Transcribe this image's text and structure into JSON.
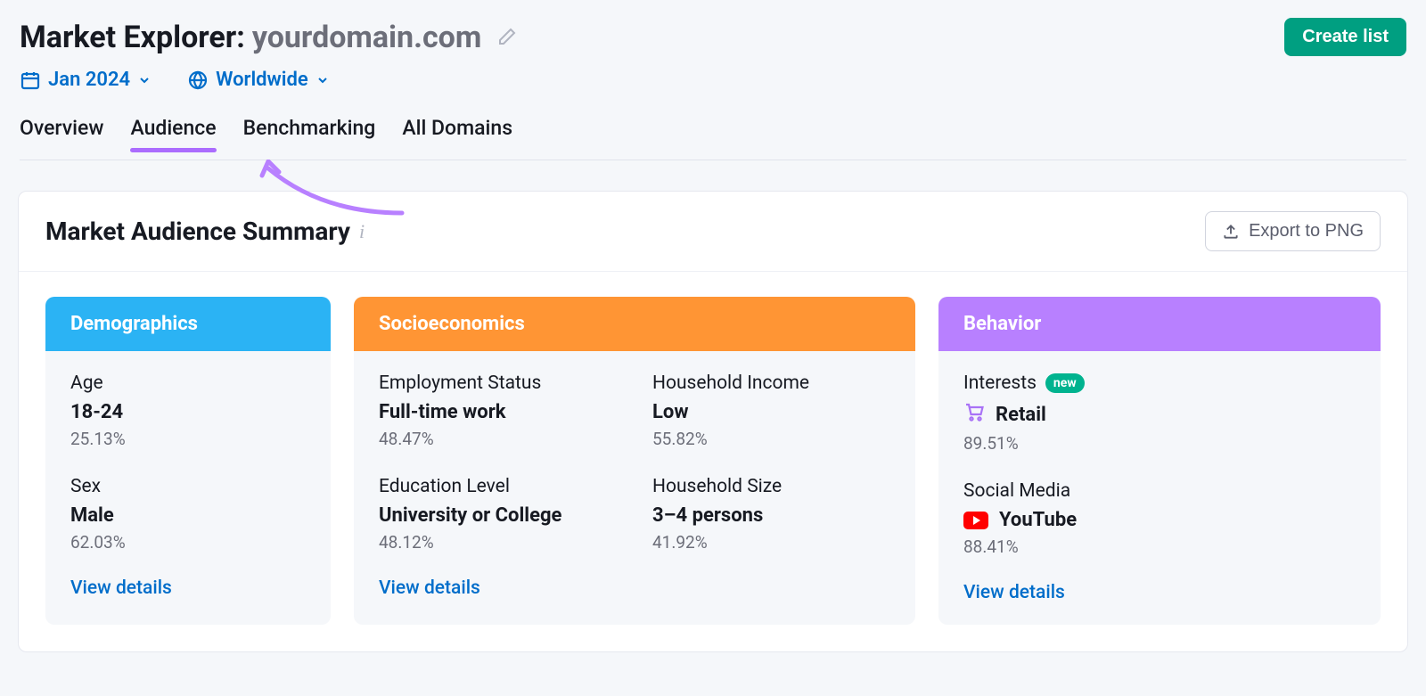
{
  "header": {
    "title_prefix": "Market Explorer: ",
    "domain": "yourdomain.com",
    "create_list_label": "Create list"
  },
  "filters": {
    "date": "Jan 2024",
    "region": "Worldwide"
  },
  "tabs": [
    {
      "label": "Overview",
      "active": false
    },
    {
      "label": "Audience",
      "active": true
    },
    {
      "label": "Benchmarking",
      "active": false
    },
    {
      "label": "All Domains",
      "active": false
    }
  ],
  "card": {
    "title": "Market Audience Summary",
    "export_label": "Export to PNG"
  },
  "panels": {
    "demographics": {
      "title": "Demographics",
      "metrics": [
        {
          "label": "Age",
          "value": "18-24",
          "pct": "25.13%"
        },
        {
          "label": "Sex",
          "value": "Male",
          "pct": "62.03%"
        }
      ],
      "view_details": "View details"
    },
    "socioeconomics": {
      "title": "Socioeconomics",
      "metrics": [
        {
          "label": "Employment Status",
          "value": "Full-time work",
          "pct": "48.47%"
        },
        {
          "label": "Household Income",
          "value": "Low",
          "pct": "55.82%"
        },
        {
          "label": "Education Level",
          "value": "University or College",
          "pct": "48.12%"
        },
        {
          "label": "Household Size",
          "value": "3–4 persons",
          "pct": "41.92%"
        }
      ],
      "view_details": "View details"
    },
    "behavior": {
      "title": "Behavior",
      "interests": {
        "label": "Interests",
        "badge": "new",
        "value": "Retail",
        "pct": "89.51%"
      },
      "social": {
        "label": "Social Media",
        "value": "YouTube",
        "pct": "88.41%"
      },
      "view_details": "View details"
    }
  }
}
